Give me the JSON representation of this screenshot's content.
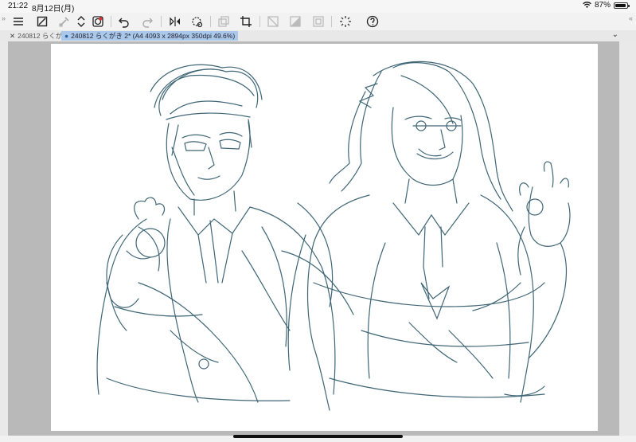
{
  "status": {
    "time": "21:22",
    "date": "8月12日(月)",
    "battery": "87%"
  },
  "tabs": [
    {
      "label": "240812 らくが"
    },
    {
      "label": "240812 らくがき 2* (A4 4093 x 2894px 350dpi 49.6%)"
    }
  ],
  "toolbar": {
    "icons": [
      "menu-icon",
      "transform-icon",
      "eyedropper-icon",
      "color-icon",
      "arrows-icon",
      "undo-icon",
      "redo-icon",
      "flip-icon",
      "rotate-icon",
      "layer-icon",
      "crop-icon",
      "clear-icon",
      "fill-icon",
      "frame-icon",
      "loading-icon",
      "help-icon"
    ]
  },
  "colors": {
    "sketch": "#3f6676",
    "active_tab": "#aac8ea"
  }
}
